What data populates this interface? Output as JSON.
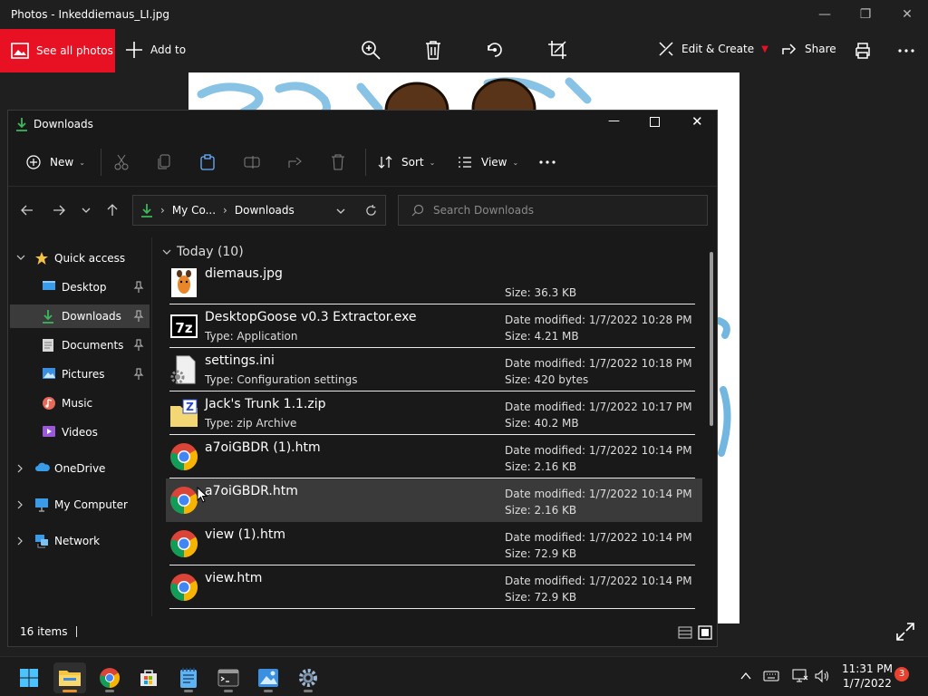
{
  "photos": {
    "title": "Photos - Inkeddiemaus_LI.jpg",
    "see_all_label": "See all photos",
    "add_to_label": "Add to",
    "edit_create_label": "Edit & Create",
    "share_label": "Share"
  },
  "explorer": {
    "title": "Downloads",
    "cmd": {
      "new_label": "New",
      "sort_label": "Sort",
      "view_label": "View"
    },
    "address": {
      "crumb1": "My Co...",
      "crumb2": "Downloads"
    },
    "search": {
      "placeholder": "Search Downloads"
    },
    "sidebar": [
      {
        "label": "Quick access",
        "icon": "star-icon"
      },
      {
        "label": "Desktop",
        "icon": "desktop-icon",
        "pinned": true
      },
      {
        "label": "Downloads",
        "icon": "download-icon",
        "pinned": true,
        "selected": true
      },
      {
        "label": "Documents",
        "icon": "documents-icon",
        "pinned": true
      },
      {
        "label": "Pictures",
        "icon": "pictures-icon",
        "pinned": true
      },
      {
        "label": "Music",
        "icon": "music-icon"
      },
      {
        "label": "Videos",
        "icon": "videos-icon"
      },
      {
        "label": "OneDrive",
        "icon": "cloud-icon"
      },
      {
        "label": "My Computer",
        "icon": "computer-icon"
      },
      {
        "label": "Network",
        "icon": "network-icon"
      }
    ],
    "group_label": "Today (10)",
    "files": [
      {
        "name": "diemaus.jpg",
        "type": "",
        "date": "",
        "size": "Size: 36.3 KB",
        "icon": "image-file-icon"
      },
      {
        "name": "DesktopGoose v0.3 Extractor.exe",
        "type": "Type: Application",
        "date": "Date modified: 1/7/2022 10:28 PM",
        "size": "Size: 4.21 MB",
        "icon": "7zip-icon"
      },
      {
        "name": "settings.ini",
        "type": "Type: Configuration settings",
        "date": "Date modified: 1/7/2022 10:18 PM",
        "size": "Size: 420 bytes",
        "icon": "settings-file-icon"
      },
      {
        "name": "Jack's Trunk 1.1.zip",
        "type": "Type: zip Archive",
        "date": "Date modified: 1/7/2022 10:17 PM",
        "size": "Size: 40.2 MB",
        "icon": "zip-file-icon"
      },
      {
        "name": "a7oiGBDR (1).htm",
        "type": "",
        "date": "Date modified: 1/7/2022 10:14 PM",
        "size": "Size: 2.16 KB",
        "icon": "chrome-file-icon"
      },
      {
        "name": "a7oiGBDR.htm",
        "type": "",
        "date": "Date modified: 1/7/2022 10:14 PM",
        "size": "Size: 2.16 KB",
        "icon": "chrome-file-icon"
      },
      {
        "name": "view (1).htm",
        "type": "",
        "date": "Date modified: 1/7/2022 10:14 PM",
        "size": "Size: 72.9 KB",
        "icon": "chrome-file-icon"
      },
      {
        "name": "view.htm",
        "type": "",
        "date": "Date modified: 1/7/2022 10:14 PM",
        "size": "Size: 72.9 KB",
        "icon": "chrome-file-icon"
      }
    ],
    "status_items": "16 items"
  },
  "taskbar": {
    "time": "11:31 PM",
    "date": "1/7/2022",
    "notifications": "3"
  },
  "colors": {
    "accent": "#e81123",
    "download_green": "#3bb85a",
    "active_indicator": "#e8912a"
  }
}
